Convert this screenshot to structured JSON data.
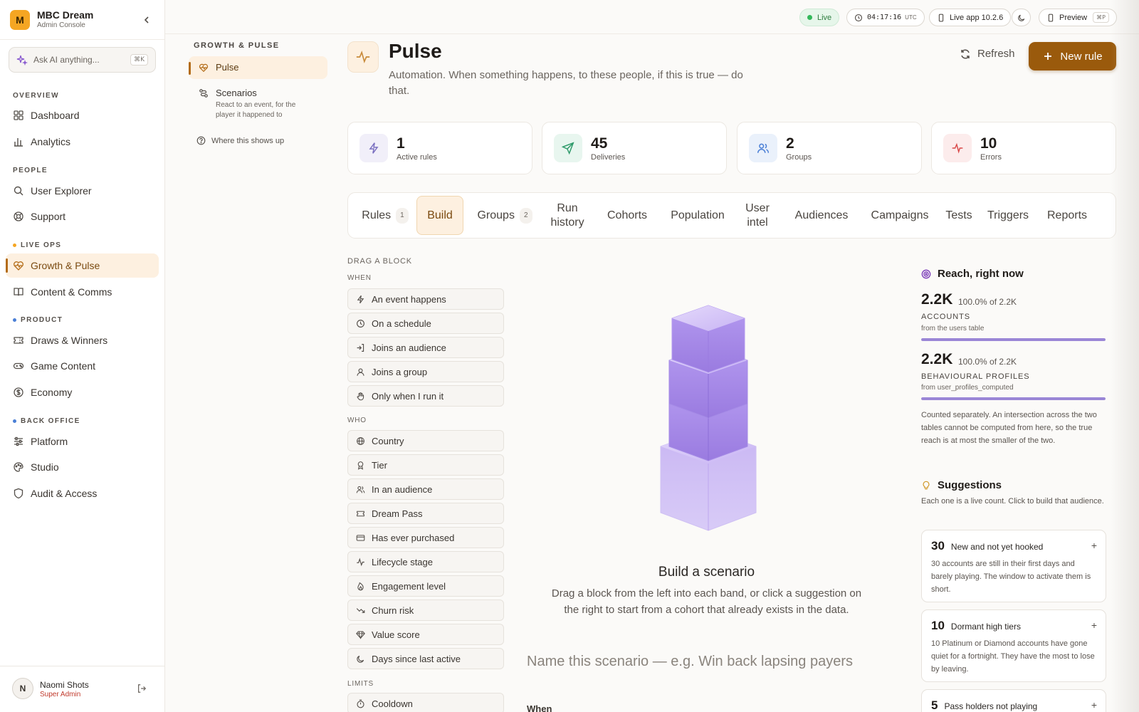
{
  "app": {
    "name": "MBC Dream",
    "subtitle": "Admin Console",
    "logo_letter": "M"
  },
  "ask_ai": {
    "placeholder": "Ask AI anything...",
    "shortcut": "⌘K"
  },
  "sidebar": {
    "sections": [
      {
        "label": "OVERVIEW"
      },
      {
        "label": "PEOPLE"
      },
      {
        "label": "LIVE OPS",
        "dot_color": "#f5a623"
      },
      {
        "label": "PRODUCT",
        "dot_color": "#4a7fd6"
      },
      {
        "label": "BACK OFFICE",
        "dot_color": "#4a7fd6"
      }
    ],
    "items": [
      {
        "label": "Dashboard",
        "icon": "grid-icon"
      },
      {
        "label": "Analytics",
        "icon": "bar-chart-icon"
      },
      {
        "label": "User Explorer",
        "icon": "search-icon"
      },
      {
        "label": "Support",
        "icon": "lifebuoy-icon"
      },
      {
        "label": "Growth & Pulse",
        "icon": "heart-pulse-icon",
        "active": true
      },
      {
        "label": "Content & Comms",
        "icon": "book-icon"
      },
      {
        "label": "Draws & Winners",
        "icon": "ticket-icon"
      },
      {
        "label": "Game Content",
        "icon": "gamepad-icon"
      },
      {
        "label": "Economy",
        "icon": "coin-icon"
      },
      {
        "label": "Platform",
        "icon": "sliders-icon"
      },
      {
        "label": "Studio",
        "icon": "palette-icon"
      },
      {
        "label": "Audit & Access",
        "icon": "shield-icon"
      }
    ]
  },
  "user": {
    "initial": "N",
    "name": "Naomi Shots",
    "role": "Super Admin"
  },
  "topbar": {
    "live": "Live",
    "clock": "04:17:16",
    "tz": "UTC",
    "app_version": "Live app 10.2.6",
    "preview": "Preview",
    "preview_shortcut": "⌘P"
  },
  "subnav": {
    "title": "GROWTH & PULSE",
    "items": [
      {
        "label": "Pulse",
        "active": true
      },
      {
        "label": "Scenarios",
        "description": "React to an event, for the player it happened to"
      }
    ],
    "where_link": "Where this shows up"
  },
  "header": {
    "title": "Pulse",
    "subtitle": "Automation. When something happens, to these people, if this is true — do that.",
    "refresh": "Refresh",
    "new_rule": "New rule"
  },
  "stats": [
    {
      "value": "1",
      "label": "Active rules",
      "color": "#7a6fc0",
      "bg": "#f1eff9",
      "icon": "bolt-icon"
    },
    {
      "value": "45",
      "label": "Deliveries",
      "color": "#2e9a6a",
      "bg": "#e8f6ef",
      "icon": "send-icon"
    },
    {
      "value": "2",
      "label": "Groups",
      "color": "#4a7fd6",
      "bg": "#eaf1fb",
      "icon": "users-icon"
    },
    {
      "value": "10",
      "label": "Errors",
      "color": "#d94a4a",
      "bg": "#fcecec",
      "icon": "pulse-icon"
    }
  ],
  "tabs": [
    {
      "label": "Rules",
      "count": "1"
    },
    {
      "label": "Build",
      "active": true
    },
    {
      "label": "Groups",
      "count": "2"
    },
    {
      "label": "Run history"
    },
    {
      "label": "Cohorts"
    },
    {
      "label": "Population"
    },
    {
      "label": "User intel"
    },
    {
      "label": "Audiences"
    },
    {
      "label": "Campaigns"
    },
    {
      "label": "Tests"
    },
    {
      "label": "Triggers"
    },
    {
      "label": "Reports"
    }
  ],
  "blocks": {
    "title": "DRAG A BLOCK",
    "when_label": "WHEN",
    "when": [
      {
        "label": "An event happens",
        "icon": "bolt-icon"
      },
      {
        "label": "On a schedule",
        "icon": "clock-icon"
      },
      {
        "label": "Joins an audience",
        "icon": "enter-icon"
      },
      {
        "label": "Joins a group",
        "icon": "user-icon"
      },
      {
        "label": "Only when I run it",
        "icon": "hand-icon"
      }
    ],
    "who_label": "WHO",
    "who": [
      {
        "label": "Country",
        "icon": "globe-icon"
      },
      {
        "label": "Tier",
        "icon": "award-icon"
      },
      {
        "label": "In an audience",
        "icon": "users-icon"
      },
      {
        "label": "Dream Pass",
        "icon": "ticket-icon"
      },
      {
        "label": "Has ever purchased",
        "icon": "card-icon"
      },
      {
        "label": "Lifecycle stage",
        "icon": "activity-icon"
      },
      {
        "label": "Engagement level",
        "icon": "flame-icon"
      },
      {
        "label": "Churn risk",
        "icon": "trend-down-icon"
      },
      {
        "label": "Value score",
        "icon": "gem-icon"
      },
      {
        "label": "Days since last active",
        "icon": "moon-icon"
      }
    ],
    "limits_label": "LIMITS",
    "limits": [
      {
        "label": "Cooldown",
        "icon": "timer-icon"
      }
    ]
  },
  "canvas": {
    "empty_title": "Build a scenario",
    "empty_text": "Drag a block from the left into each band, or click a suggestion on the right to start from a cohort that already exists in the data.",
    "name_placeholder": "Name this scenario — e.g. Win back lapsing payers",
    "when_label": "When"
  },
  "reach": {
    "title": "Reach, right now",
    "rows": [
      {
        "value": "2.2K",
        "pct": "100.0% of 2.2K",
        "label": "ACCOUNTS",
        "source": "from the users table",
        "fill": 1.0
      },
      {
        "value": "2.2K",
        "pct": "100.0% of 2.2K",
        "label": "BEHAVIOURAL PROFILES",
        "source": "from user_profiles_computed",
        "fill": 1.0
      }
    ],
    "note": "Counted separately. An intersection across the two tables cannot be computed from here, so the true reach is at most the smaller of the two."
  },
  "suggestions": {
    "title": "Suggestions",
    "subtitle": "Each one is a live count. Click to build that audience.",
    "items": [
      {
        "count": "30",
        "name": "New and not yet hooked",
        "description": "30 accounts are still in their first days and barely playing. The window to activate them is short."
      },
      {
        "count": "10",
        "name": "Dormant high tiers",
        "description": "10 Platinum or Diamond accounts have gone quiet for a fortnight. They have the most to lose by leaving."
      },
      {
        "count": "5",
        "name": "Pass holders not playing",
        "description": ""
      }
    ]
  }
}
